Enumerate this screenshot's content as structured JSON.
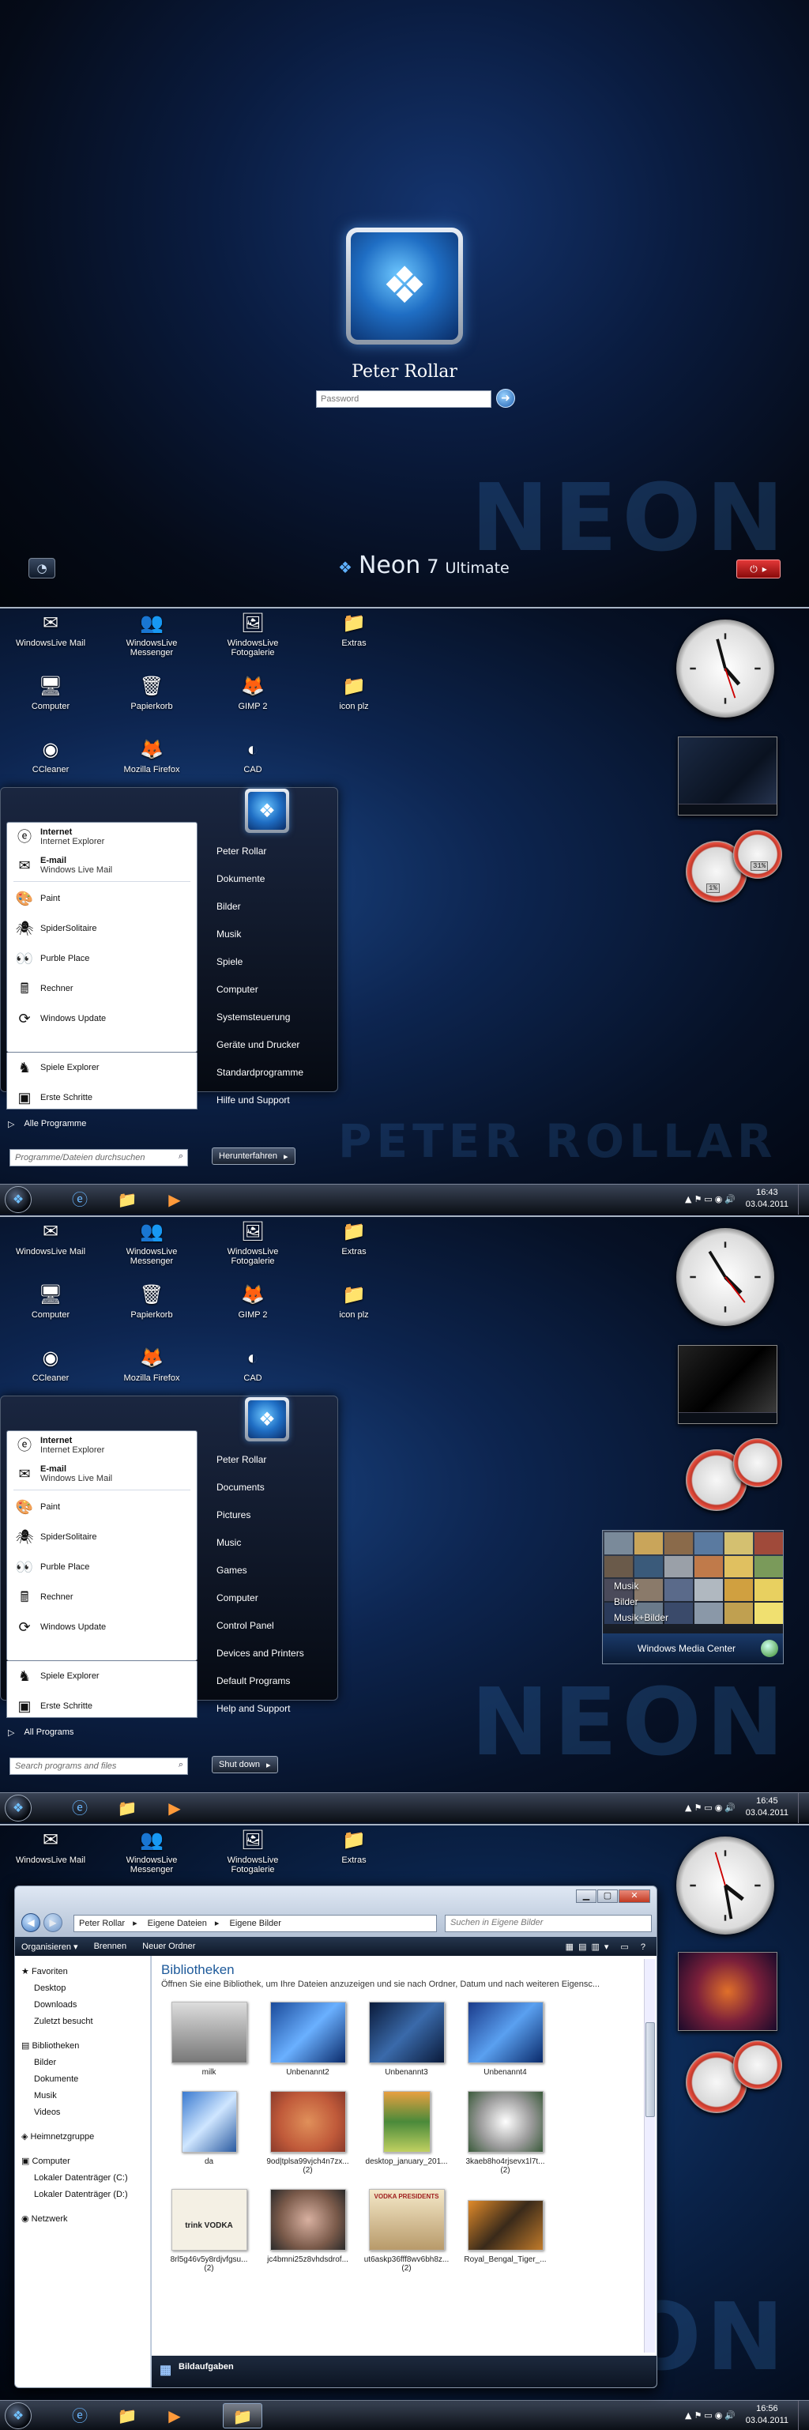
{
  "logon": {
    "user_name": "Peter Rollar",
    "password_placeholder": "Password",
    "watermark": "NEON",
    "brand_name": "Neon",
    "brand_version": "7",
    "brand_edition": "Ultimate"
  },
  "desktop_icons": [
    "WindowsLive Mail",
    "WindowsLive Messenger",
    "WindowsLive Fotogalerie",
    "Extras",
    "Computer",
    "Papierkorb",
    "GIMP 2",
    "icon plz",
    "CCleaner",
    "Mozilla Firefox",
    "CAD"
  ],
  "desktop_icons_short": [
    "WindowsLive Mail",
    "WindowsLive Messenger",
    "WindowsLive Fotogalerie",
    "Extras"
  ],
  "start_menu_de": {
    "pinned": [
      {
        "name": "Internet",
        "sub": "Internet Explorer"
      },
      {
        "name": "E-mail",
        "sub": "Windows Live Mail"
      }
    ],
    "recent": [
      "Paint",
      "SpiderSolitaire",
      "Purble Place",
      "Rechner",
      "Windows Update",
      "Spiele Explorer",
      "Erste Schritte"
    ],
    "all_programs": "Alle Programme",
    "search_placeholder": "Programme/Dateien durchsuchen",
    "right": [
      "Peter Rollar",
      "Dokumente",
      "Bilder",
      "Musik",
      "Spiele",
      "Computer",
      "Systemsteuerung",
      "Geräte und Drucker",
      "Standardprogramme",
      "Hilfe und Support"
    ],
    "shutdown": "Herunterfahren",
    "watermark": "PETER ROLLAR"
  },
  "start_menu_en": {
    "pinned": [
      {
        "name": "Internet",
        "sub": "Internet Explorer"
      },
      {
        "name": "E-mail",
        "sub": "Windows Live Mail"
      }
    ],
    "recent": [
      "Paint",
      "SpiderSolitaire",
      "Purble Place",
      "Rechner",
      "Windows Update",
      "Spiele Explorer",
      "Erste Schritte"
    ],
    "all_programs": "All Programs",
    "search_placeholder": "Search programs and files",
    "right": [
      "Peter Rollar",
      "Documents",
      "Pictures",
      "Music",
      "Games",
      "Computer",
      "Control Panel",
      "Devices and Printers",
      "Default Programs",
      "Help and Support"
    ],
    "shutdown": "Shut down",
    "watermark": "NEON"
  },
  "media_center": {
    "items": [
      "Musik",
      "Bilder",
      "Musik+Bilder"
    ],
    "footer": "Windows Media Center"
  },
  "taskbars": [
    {
      "time": "16:43",
      "date": "03.04.2011"
    },
    {
      "time": "16:45",
      "date": "03.04.2011"
    },
    {
      "time": "16:56",
      "date": "03.04.2011"
    }
  ],
  "gadgets": {
    "cpu_values": [
      "1%",
      "31%"
    ]
  },
  "explorer": {
    "address": [
      "Peter Rollar",
      "Eigene Dateien",
      "Eigene Bilder"
    ],
    "search_placeholder": "Suchen in Eigene Bilder",
    "commands": [
      "Organisieren",
      "Brennen",
      "Neuer Ordner"
    ],
    "tree": {
      "favorites_title": "Favoriten",
      "favorites": [
        "Desktop",
        "Downloads",
        "Zuletzt besucht"
      ],
      "libraries_title": "Bibliotheken",
      "libraries": [
        "Bilder",
        "Dokumente",
        "Musik",
        "Videos"
      ],
      "homegroup": "Heimnetzgruppe",
      "computer_title": "Computer",
      "drives": [
        "Lokaler Datenträger (C:)",
        "Lokaler Datenträger (D:)"
      ],
      "network": "Netzwerk"
    },
    "library_title": "Bibliotheken",
    "library_desc": "Öffnen Sie eine Bibliothek, um Ihre Dateien anzuzeigen und sie nach Ordner, Datum und nach weiteren Eigensc...",
    "files": [
      {
        "label": "milk",
        "count": ""
      },
      {
        "label": "Unbenannt2",
        "count": ""
      },
      {
        "label": "Unbenannt3",
        "count": ""
      },
      {
        "label": "Unbenannt4",
        "count": ""
      },
      {
        "label": "da",
        "count": ""
      },
      {
        "label": "9od|tplsa99vjch4n7zx...",
        "count": "(2)"
      },
      {
        "label": "desktop_january_201...",
        "count": ""
      },
      {
        "label": "3kaeb8ho4rjsevx1l7t...",
        "count": "(2)"
      },
      {
        "label": "8rl5g46v5y8rdjvfgsu...",
        "count": "(2)"
      },
      {
        "label": "jc4bmni25z8vhdsdrof...",
        "count": ""
      },
      {
        "label": "ut6askp36fff8wv6bh8z...",
        "count": "(2)"
      },
      {
        "label": "Royal_Bengal_Tiger_...",
        "count": ""
      }
    ],
    "file_texts": {
      "vodka": "trink VODKA",
      "vodka_pres": "VODKA PRESIDENTS"
    },
    "details_label": "Bildaufgaben"
  }
}
